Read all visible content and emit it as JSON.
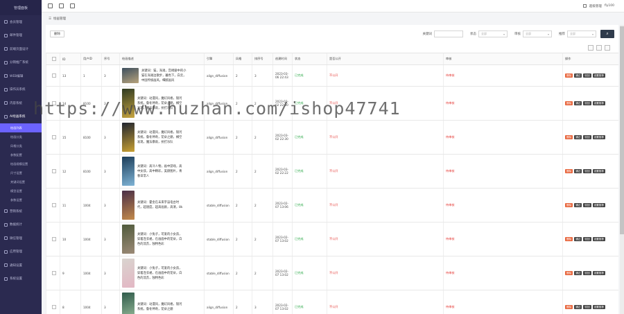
{
  "sidebar": {
    "title": "管理面板",
    "items": [
      {
        "label": "会员管理"
      },
      {
        "label": "邮件管理"
      },
      {
        "label": "前端页面设计"
      },
      {
        "label": "分销推广系统"
      },
      {
        "label": "WEB编辑"
      },
      {
        "label": "操作员系统"
      },
      {
        "label": "内容系统"
      },
      {
        "label": "AI绘画系统"
      }
    ],
    "sub_items": [
      {
        "label": "绘画列表"
      },
      {
        "label": "绘画分类"
      },
      {
        "label": "风格分类"
      },
      {
        "label": "参数配置"
      },
      {
        "label": "绘画规模设置"
      },
      {
        "label": "尺寸设置"
      },
      {
        "label": "关键词设置"
      },
      {
        "label": "模型设置"
      },
      {
        "label": "参数设置"
      }
    ],
    "bottom_items": [
      {
        "label": "营销系统"
      },
      {
        "label": "数据统计"
      },
      {
        "label": "微信管理"
      },
      {
        "label": "应用管理"
      },
      {
        "label": "通知设置"
      },
      {
        "label": "系统设置"
      }
    ]
  },
  "topbar": {
    "user": "超级管理",
    "version": "fly100"
  },
  "breadcrumb": "绘画管理",
  "toolbar": {
    "delete_label": "删除",
    "filters": [
      {
        "label": "关键词",
        "type": "input",
        "value": ""
      },
      {
        "label": "状态",
        "type": "select",
        "value": "全部"
      },
      {
        "label": "审核",
        "type": "select",
        "value": "全部"
      },
      {
        "label": "推荐",
        "type": "select",
        "value": "全部"
      }
    ]
  },
  "table": {
    "columns": [
      "ID",
      "用户ID",
      "序号",
      "绘画描述",
      "引擎",
      "风格",
      "排序号",
      "创建时间",
      "状态",
      "是否公开",
      "审核",
      "操作"
    ],
    "rows": [
      {
        "id": "13",
        "uid": "1",
        "seq": "3",
        "prompt": "关键词：猫，海滩，宫崎骏中的小猫在海滩边散步，暮色下，白云，中国传统画风，细腻画风",
        "engine": "align_diffusion",
        "style": "2",
        "order": "3",
        "time": "2023-03-06 22:43",
        "status": "已完成",
        "public": "不公开",
        "audit": "待审核",
        "thumb": [
          "#3d4f5e",
          "#b8a47c"
        ]
      },
      {
        "id": "14",
        "uid": "8100",
        "seq": "3",
        "prompt": "关键词：动漫风，魔幻风格，银河系统，鲁冬神奇，花朵之巅，横空发现，魔法暴雨，抗打乐队",
        "engine": "align_diffusion",
        "style": "2",
        "order": "2",
        "time": "2023-03-02 22:30",
        "status": "已完成",
        "public": "不公开",
        "audit": "待审核",
        "thumb": [
          "#2e3a22",
          "#c8a540"
        ]
      },
      {
        "id": "15",
        "uid": "8100",
        "seq": "3",
        "prompt": "关键词：动漫风，魔幻风格，银河系统，鲁冬神奇，花朵之巅，横空发现，魔法暴雨，抗打乐队",
        "engine": "align_diffusion",
        "style": "2",
        "order": "2",
        "time": "2023-03-02 22:30",
        "status": "已完成",
        "public": "不公开",
        "audit": "待审核",
        "thumb": [
          "#1f2430",
          "#c9a133"
        ]
      },
      {
        "id": "12",
        "uid": "8100",
        "seq": "3",
        "prompt": "关键词：高冷人物，画中游戏，高中女孩，高中精彩，美颜图片，青春日常人",
        "engine": "align_diffusion",
        "style": "2",
        "order": "2",
        "time": "2023-03-02 22:22",
        "status": "已完成",
        "public": "不公开",
        "audit": "待审核",
        "thumb": [
          "#1b3c58",
          "#7fb4d6"
        ]
      },
      {
        "id": "11",
        "uid": "1004",
        "seq": "3",
        "prompt": "关键词：霍金在未来宇宙电台时代，超速度，超高画质，高清，8k",
        "engine": "stable_diffusion",
        "style": "2",
        "order": "2",
        "time": "2023-02-07 13:06",
        "status": "已完成",
        "public": "不公开",
        "audit": "待审核",
        "thumb": [
          "#4a2f48",
          "#c48a4a"
        ]
      },
      {
        "id": "10",
        "uid": "1004",
        "seq": "3",
        "prompt": "关键词：小兔子，可爱的小女孩，穿着连衣裙，在画面中的花朵，白色的流苏，独特色彩",
        "engine": "stable_diffusion",
        "style": "2",
        "order": "2",
        "time": "2023-02-07 13:02",
        "status": "已完成",
        "public": "不公开",
        "audit": "待审核",
        "thumb": [
          "#4f5a3b",
          "#9c8a77"
        ]
      },
      {
        "id": "9",
        "uid": "1004",
        "seq": "3",
        "prompt": "关键词：小兔子，可爱的小女孩，穿着连衣裙，在画面中的花朵，白色的流苏，独特色彩",
        "engine": "stable_diffusion",
        "style": "2",
        "order": "2",
        "time": "2023-02-07 13:02",
        "status": "已完成",
        "public": "不公开",
        "audit": "待审核",
        "thumb": [
          "#d9d4cf",
          "#e3b7c4"
        ]
      },
      {
        "id": "8",
        "uid": "1004",
        "seq": "3",
        "prompt": "关键词：动漫风，魔幻风格，银河系统，鲁冬神奇，花朵之巅",
        "engine": "align_diffusion",
        "style": "2",
        "order": "3",
        "time": "2023-02-07 13:02",
        "status": "已完成",
        "public": "不公开",
        "audit": "待审核",
        "thumb": [
          "#2f5a4a",
          "#9fc2a0"
        ]
      }
    ],
    "actions": [
      "删除",
      "通过",
      "驳回",
      "设置推荐"
    ]
  },
  "watermark": "https://www.huzhan.com/ishop47741"
}
